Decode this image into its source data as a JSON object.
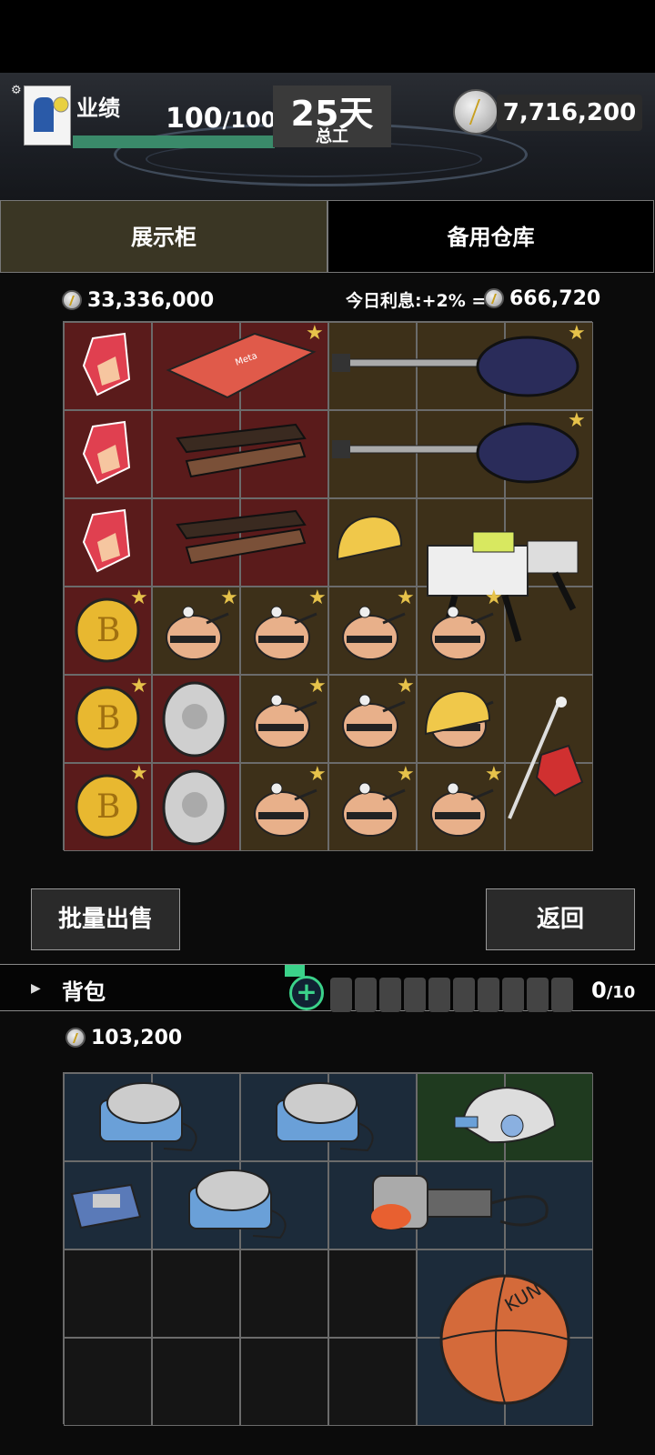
{
  "hud": {
    "perf_label": "业绩",
    "perf_current": "100",
    "perf_max": "/100",
    "perf_fill_fraction": 1.0,
    "day_value": "25天",
    "day_sub": "总工",
    "money": "7,716,200"
  },
  "tabs": {
    "display": "展示柜",
    "storage": "备用仓库"
  },
  "showcase": {
    "value": "33,336,000",
    "interest_label": "今日利息:+2% =",
    "interest_value": "666,720"
  },
  "buttons": {
    "bulk_sell": "批量出售",
    "back": "返回"
  },
  "backpack": {
    "label": "背包",
    "count": "0",
    "capacity": "/10",
    "value": "103,200"
  },
  "colors": {
    "red_cell": "#5a1b1b",
    "brown_cell": "#3d3019",
    "blue_cell": "#1c2b3a",
    "green_cell": "#1f3a1f",
    "star": "#e6c24a",
    "accent_green": "#3bd28a"
  }
}
